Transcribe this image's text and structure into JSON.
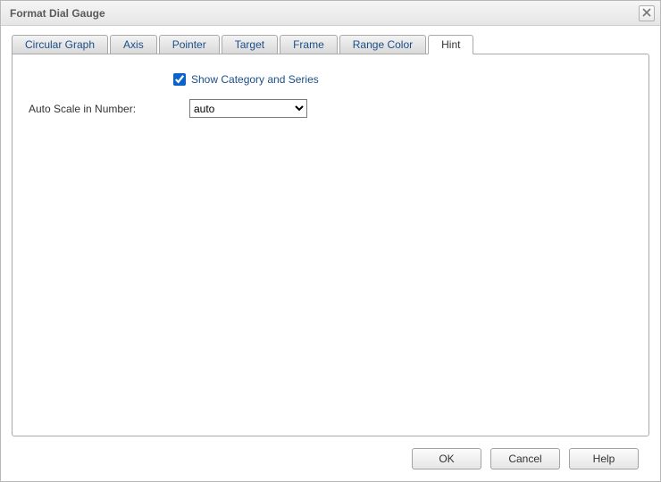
{
  "title": "Format Dial Gauge",
  "tabs": [
    {
      "label": "Circular Graph",
      "active": false
    },
    {
      "label": "Axis",
      "active": false
    },
    {
      "label": "Pointer",
      "active": false
    },
    {
      "label": "Target",
      "active": false
    },
    {
      "label": "Frame",
      "active": false
    },
    {
      "label": "Range Color",
      "active": false
    },
    {
      "label": "Hint",
      "active": true
    }
  ],
  "hintPanel": {
    "showCategoryAndSeries": {
      "label": "Show Category and Series",
      "checked": true
    },
    "autoScale": {
      "label": "Auto Scale in Number:",
      "value": "auto",
      "options": [
        "auto"
      ]
    }
  },
  "buttons": {
    "ok": "OK",
    "cancel": "Cancel",
    "help": "Help"
  }
}
